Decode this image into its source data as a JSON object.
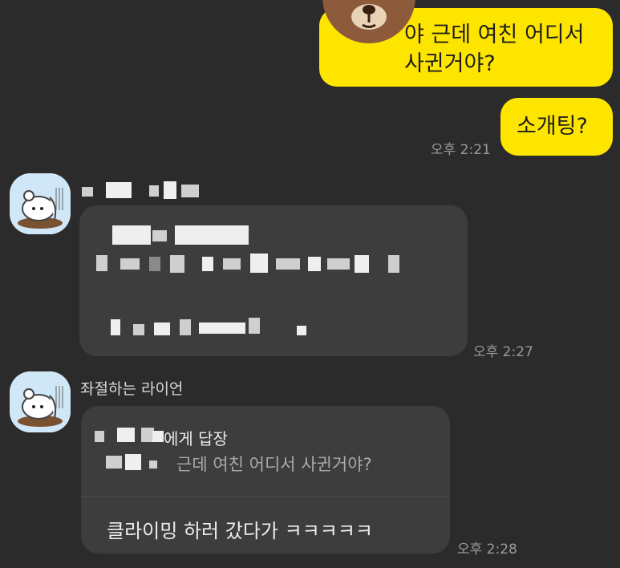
{
  "messages": {
    "out1_text": "야 근데 여친 어디서 사귄거야?",
    "out2_text": "소개팅?",
    "out2_time": "오후 2:21",
    "in1_time": "오후 2:27",
    "in2_sender": "좌절하는 라이언",
    "in2_reply_header": "에게 답장",
    "in2_reply_quote": "근데 여친 어디서 사귄거야?",
    "in2_text": "클라이밍 하러 갔다가 ㅋㅋㅋㅋㅋ",
    "in2_time": "오후 2:28"
  },
  "colors": {
    "background": "#2b2b2b",
    "outgoing_bubble": "#fee500",
    "incoming_bubble": "#3d3d3d",
    "timestamp": "#9a9a9a"
  },
  "icons": {
    "outgoing_sticker": "brown-bear-icon",
    "avatar": "ryan-sad-avatar-icon"
  }
}
